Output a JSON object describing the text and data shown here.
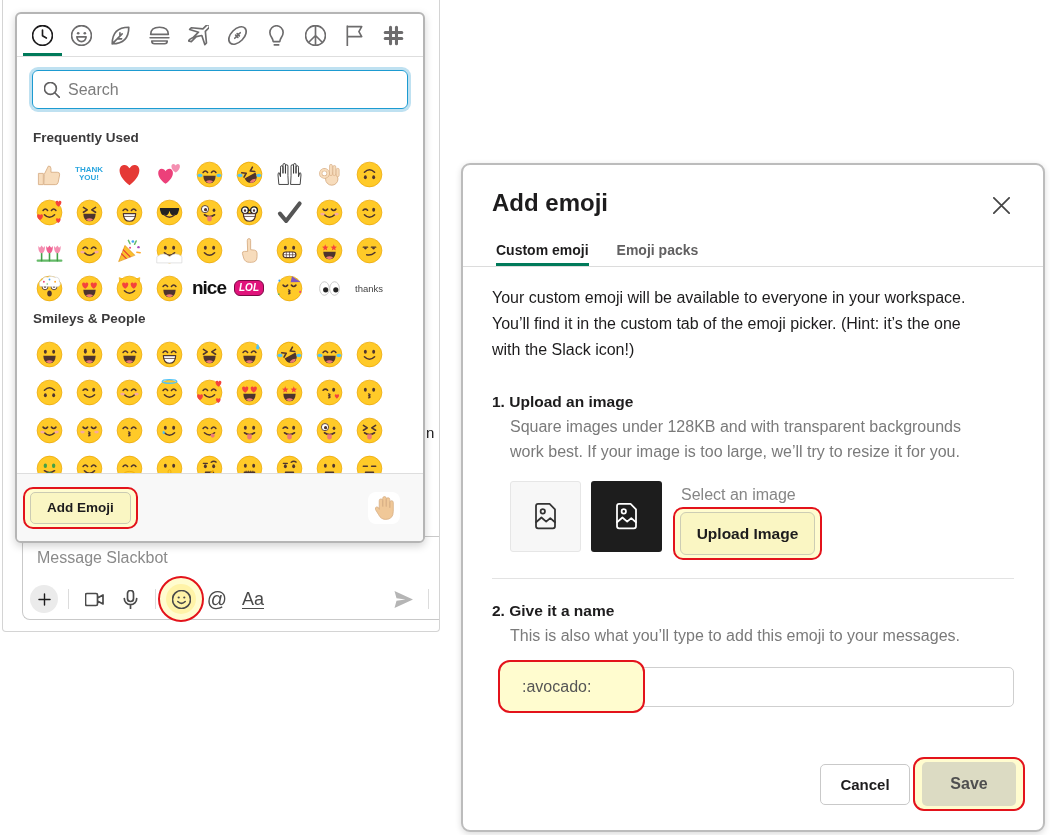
{
  "picker": {
    "tabs": [
      {
        "kind": "recent",
        "selected": true
      },
      {
        "kind": "people",
        "selected": false
      },
      {
        "kind": "nature",
        "selected": false
      },
      {
        "kind": "food",
        "selected": false
      },
      {
        "kind": "travel",
        "selected": false
      },
      {
        "kind": "activity",
        "selected": false
      },
      {
        "kind": "objects",
        "selected": false
      },
      {
        "kind": "symbols",
        "selected": false
      },
      {
        "kind": "flags",
        "selected": false
      },
      {
        "kind": "custom",
        "selected": false
      }
    ],
    "search": {
      "placeholder": "Search"
    },
    "sections": [
      {
        "title": "Frequently Used",
        "emoji": [
          {
            "kind": "thumbsup"
          },
          {
            "kind": "caption",
            "text": "THANK YOU!"
          },
          {
            "kind": "heart"
          },
          {
            "kind": "twohearts"
          },
          {
            "kind": "joy"
          },
          {
            "kind": "rofl"
          },
          {
            "kind": "highfive"
          },
          {
            "kind": "okhand"
          },
          {
            "kind": "upside"
          },
          {
            "kind": "hearts"
          },
          {
            "kind": "laughing"
          },
          {
            "kind": "grin"
          },
          {
            "kind": "sunglasses"
          },
          {
            "kind": "zany"
          },
          {
            "kind": "nerd"
          },
          {
            "kind": "check"
          },
          {
            "kind": "relaxed"
          },
          {
            "kind": "wink"
          },
          {
            "kind": "flowers"
          },
          {
            "kind": "blush"
          },
          {
            "kind": "popper"
          },
          {
            "kind": "peek"
          },
          {
            "kind": "slight"
          },
          {
            "kind": "pointup"
          },
          {
            "kind": "grimace"
          },
          {
            "kind": "starstruck"
          },
          {
            "kind": "smirk"
          },
          {
            "kind": "exploding"
          },
          {
            "kind": "hearteyes"
          },
          {
            "kind": "cat"
          },
          {
            "kind": "smile"
          },
          {
            "kind": "wordmark",
            "text": "nice"
          },
          {
            "kind": "badge",
            "text": "LOL"
          },
          {
            "kind": "partying"
          },
          {
            "kind": "eyes"
          },
          {
            "kind": "note",
            "text": "thanks"
          }
        ]
      },
      {
        "title": "Smileys & People",
        "emoji": [
          {
            "kind": "grinning"
          },
          {
            "kind": "smiley"
          },
          {
            "kind": "smile"
          },
          {
            "kind": "grin"
          },
          {
            "kind": "laughing"
          },
          {
            "kind": "sweat"
          },
          {
            "kind": "rofl"
          },
          {
            "kind": "joy"
          },
          {
            "kind": "slight"
          },
          {
            "kind": "upside"
          },
          {
            "kind": "wink"
          },
          {
            "kind": "blush"
          },
          {
            "kind": "innocent"
          },
          {
            "kind": "hearts"
          },
          {
            "kind": "hearteyes"
          },
          {
            "kind": "starstruck"
          },
          {
            "kind": "kissheart"
          },
          {
            "kind": "kissing"
          },
          {
            "kind": "relaxed"
          },
          {
            "kind": "kissclosed"
          },
          {
            "kind": "kisssmile"
          },
          {
            "kind": "tear"
          },
          {
            "kind": "yum"
          },
          {
            "kind": "tongue"
          },
          {
            "kind": "winktongue"
          },
          {
            "kind": "zany"
          },
          {
            "kind": "squinttongue"
          },
          {
            "kind": "money"
          },
          {
            "kind": "hugging"
          },
          {
            "kind": "gasp"
          },
          {
            "kind": "shush"
          },
          {
            "kind": "thinking"
          },
          {
            "kind": "zipper"
          },
          {
            "kind": "eyebrow"
          },
          {
            "kind": "neutral"
          },
          {
            "kind": "expressionless"
          }
        ]
      }
    ],
    "add_button": {
      "label": "Add Emoji",
      "highlighted": true
    }
  },
  "background_text": "n",
  "composer": {
    "placeholder": "Message Slackbot",
    "tool_groups": [
      [
        {
          "kind": "plus",
          "highlighted": false
        }
      ],
      [
        {
          "kind": "video",
          "highlighted": false
        },
        {
          "kind": "mic",
          "highlighted": false
        }
      ],
      [
        {
          "kind": "emoji",
          "highlighted": true
        },
        {
          "kind": "mention",
          "label": "@",
          "highlighted": false
        },
        {
          "kind": "format",
          "label": "Aa",
          "highlighted": false
        }
      ]
    ],
    "send_tools": [
      {
        "kind": "send",
        "highlighted": false
      }
    ]
  },
  "dialog": {
    "title": "Add emoji",
    "tabs": [
      {
        "label": "Custom emoji",
        "selected": true
      },
      {
        "label": "Emoji packs",
        "selected": false
      }
    ],
    "intro": "Your custom emoji will be available to everyone in your workspace. You’ll find it in the custom tab of the emoji picker. (Hint: it’s the one with the Slack icon!)",
    "upload": {
      "heading": "1. Upload an image",
      "hint": "Square images under 128KB and with transparent backgrounds work best. If your image is too large, we’ll try to resize it for you.",
      "select_label": "Select an image",
      "button": {
        "label": "Upload Image",
        "highlighted": true
      }
    },
    "name": {
      "heading": "2. Give it a name",
      "hint": "This is also what you’ll type to add this emoji to your messages.",
      "value": ":avocado:",
      "highlighted": true
    },
    "buttons": [
      {
        "kind": "cancel",
        "label": "Cancel",
        "highlighted": false,
        "disabled": false
      },
      {
        "kind": "save",
        "label": "Save",
        "highlighted": true,
        "disabled": true
      }
    ]
  }
}
